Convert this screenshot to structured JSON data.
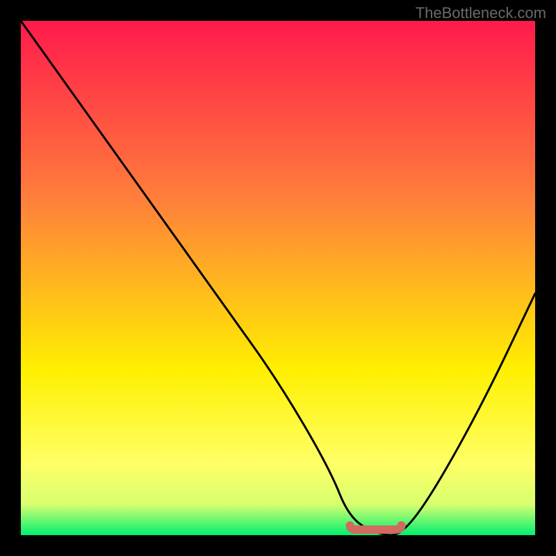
{
  "attribution": "TheBottleneck.com",
  "colors": {
    "gradient_top": "#ff1a4b",
    "gradient_mid1": "#ff803b",
    "gradient_mid2": "#fff000",
    "gradient_bottom_yellow": "#ffff66",
    "gradient_bottom_green": "#00f070",
    "curve": "#000000",
    "marker": "#d26a60",
    "frame": "#000000"
  },
  "chart_data": {
    "type": "line",
    "title": "",
    "xlabel": "",
    "ylabel": "",
    "xlim": [
      0,
      100
    ],
    "ylim": [
      0,
      100
    ],
    "grid": false,
    "legend": false,
    "series": [
      {
        "name": "bottleneck-curve",
        "x": [
          0,
          10,
          20,
          30,
          40,
          50,
          60,
          64,
          70,
          74,
          80,
          90,
          100
        ],
        "y": [
          100,
          86,
          72,
          58,
          44,
          30,
          13,
          3,
          0,
          0,
          8,
          26,
          47
        ]
      }
    ],
    "marker": {
      "name": "optimal-range",
      "x": [
        64,
        74
      ],
      "y": [
        0,
        0
      ]
    },
    "background_gradient_stops": [
      {
        "offset": 0,
        "color": "#ff1a4b"
      },
      {
        "offset": 35,
        "color": "#ff803b"
      },
      {
        "offset": 68,
        "color": "#fff000"
      },
      {
        "offset": 86,
        "color": "#ffff66"
      },
      {
        "offset": 94,
        "color": "#d8ff70"
      },
      {
        "offset": 100,
        "color": "#00f070"
      }
    ]
  }
}
